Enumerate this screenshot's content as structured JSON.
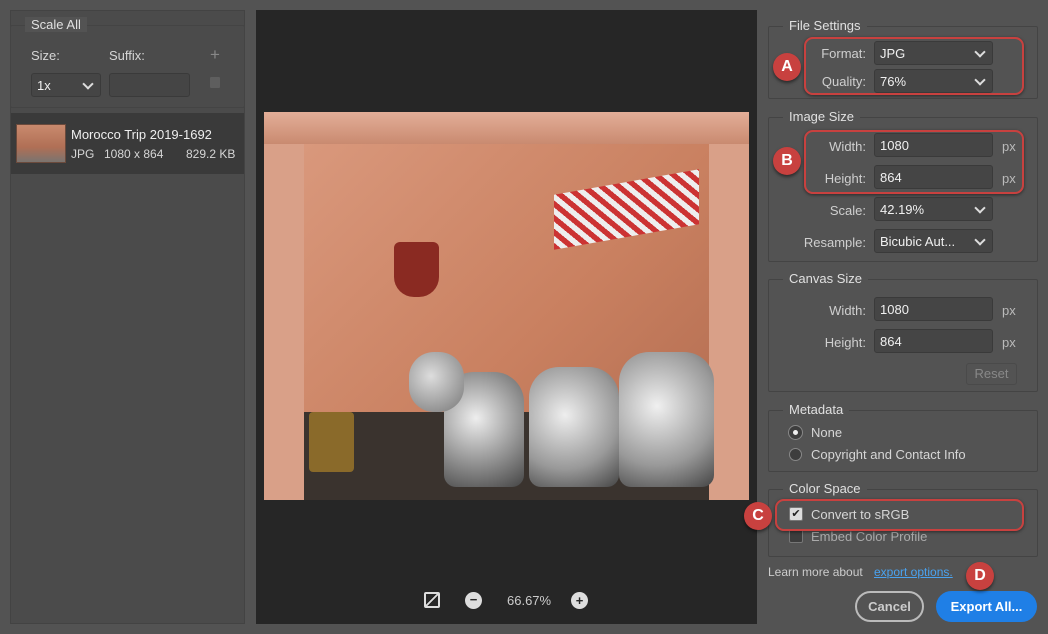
{
  "scale_all": {
    "legend": "Scale All",
    "size_label": "Size:",
    "suffix_label": "Suffix:",
    "size_value": "1x",
    "suffix_value": "",
    "add_icon": "plus-icon",
    "delete_icon": "trash-icon"
  },
  "asset": {
    "name": "Morocco Trip 2019-1692",
    "format": "JPG",
    "dimensions": "1080 x 864",
    "filesize": "829.2 KB"
  },
  "preview": {
    "zoom": "66.67%"
  },
  "file_settings": {
    "legend": "File Settings",
    "format_label": "Format:",
    "format_value": "JPG",
    "quality_label": "Quality:",
    "quality_value": "76%"
  },
  "image_size": {
    "legend": "Image Size",
    "width_label": "Width:",
    "width_value": "1080",
    "height_label": "Height:",
    "height_value": "864",
    "unit": "px",
    "scale_label": "Scale:",
    "scale_value": "42.19%",
    "resample_label": "Resample:",
    "resample_value": "Bicubic Aut..."
  },
  "canvas_size": {
    "legend": "Canvas Size",
    "width_label": "Width:",
    "width_value": "1080",
    "height_label": "Height:",
    "height_value": "864",
    "unit": "px",
    "reset": "Reset"
  },
  "metadata": {
    "legend": "Metadata",
    "options": [
      "None",
      "Copyright and Contact Info"
    ],
    "selected": "None"
  },
  "color_space": {
    "legend": "Color Space",
    "convert": "Convert to sRGB",
    "convert_checked": true,
    "embed": "Embed Color Profile",
    "embed_checked": false
  },
  "footer": {
    "learn_text": "Learn more about",
    "link": "export options.",
    "cancel": "Cancel",
    "export": "Export All..."
  },
  "annotations": {
    "a": "A",
    "b": "B",
    "c": "C",
    "d": "D",
    "color": "#c8413f"
  },
  "colors": {
    "accent": "#1f7fe6",
    "link": "#4aa3f0"
  }
}
